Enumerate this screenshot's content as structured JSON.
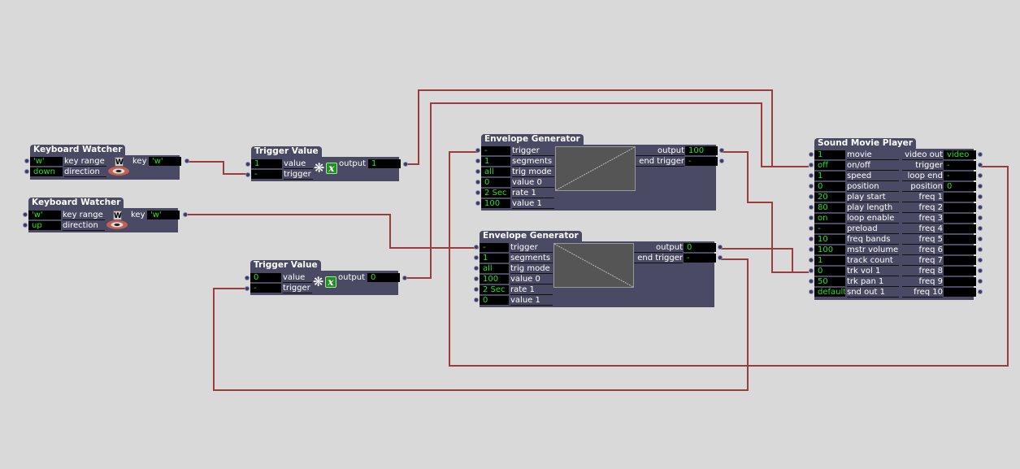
{
  "colors": {
    "background": "#d9d9d9",
    "actor_body": "#4a4a64",
    "value_text": "#22e622",
    "wire": "#993d3d"
  },
  "keyboard_watcher_1": {
    "title": "Keyboard Watcher",
    "inputs": [
      {
        "value": "'w'",
        "label": "key range"
      },
      {
        "value": "down",
        "label": "direction"
      }
    ],
    "output": {
      "label": "key",
      "value": "'w'"
    },
    "icon_letter": "W"
  },
  "keyboard_watcher_2": {
    "title": "Keyboard Watcher",
    "inputs": [
      {
        "value": "'w'",
        "label": "key range"
      },
      {
        "value": "up",
        "label": "direction"
      }
    ],
    "output": {
      "label": "key",
      "value": "'w'"
    },
    "icon_letter": "W"
  },
  "trigger_value_1": {
    "title": "Trigger Value",
    "inputs": [
      {
        "value": "1",
        "label": "value"
      },
      {
        "value": "-",
        "label": "trigger"
      }
    ],
    "output": {
      "label": "output",
      "value": "1"
    },
    "icon_letter": "x"
  },
  "trigger_value_2": {
    "title": "Trigger Value",
    "inputs": [
      {
        "value": "0",
        "label": "value"
      },
      {
        "value": "-",
        "label": "trigger"
      }
    ],
    "output": {
      "label": "output",
      "value": "0"
    },
    "icon_letter": "x"
  },
  "envelope_generator_1": {
    "title": "Envelope Generator",
    "inputs": [
      {
        "value": "-",
        "label": "trigger"
      },
      {
        "value": "1",
        "label": "segments"
      },
      {
        "value": "all",
        "label": "trig mode"
      },
      {
        "value": "0",
        "label": "value 0"
      },
      {
        "value": "2 Sec",
        "label": "rate 1"
      },
      {
        "value": "100",
        "label": "value 1"
      }
    ],
    "outputs": [
      {
        "label": "output",
        "value": "100"
      },
      {
        "label": "end trigger",
        "value": "-"
      }
    ],
    "curve": {
      "start": 0,
      "end": 100
    }
  },
  "envelope_generator_2": {
    "title": "Envelope Generator",
    "inputs": [
      {
        "value": "-",
        "label": "trigger"
      },
      {
        "value": "1",
        "label": "segments"
      },
      {
        "value": "all",
        "label": "trig mode"
      },
      {
        "value": "100",
        "label": "value 0"
      },
      {
        "value": "2 Sec",
        "label": "rate 1"
      },
      {
        "value": "0",
        "label": "value 1"
      }
    ],
    "outputs": [
      {
        "label": "output",
        "value": "0"
      },
      {
        "label": "end trigger",
        "value": "-"
      }
    ],
    "curve": {
      "start": 100,
      "end": 0
    }
  },
  "sound_movie_player": {
    "title": "Sound Movie Player",
    "inputs": [
      {
        "value": "1",
        "label": "movie"
      },
      {
        "value": "off",
        "label": "on/off"
      },
      {
        "value": "1",
        "label": "speed"
      },
      {
        "value": "0",
        "label": "position"
      },
      {
        "value": "20",
        "label": "play start"
      },
      {
        "value": "80",
        "label": "play length"
      },
      {
        "value": "on",
        "label": "loop enable"
      },
      {
        "value": "-",
        "label": "preload"
      },
      {
        "value": "10",
        "label": "freq bands"
      },
      {
        "value": "100",
        "label": "mstr volume"
      },
      {
        "value": "1",
        "label": "track count"
      },
      {
        "value": "0",
        "label": "trk vol 1"
      },
      {
        "value": "50",
        "label": "trk pan 1"
      },
      {
        "value": "default",
        "label": "snd out 1"
      }
    ],
    "outputs": [
      {
        "label": "video out",
        "value": "video"
      },
      {
        "label": "trigger",
        "value": "-"
      },
      {
        "label": "loop end",
        "value": "-"
      },
      {
        "label": "position",
        "value": "0"
      },
      {
        "label": "freq 1",
        "value": ""
      },
      {
        "label": "freq 2",
        "value": ""
      },
      {
        "label": "freq 3",
        "value": ""
      },
      {
        "label": "freq 4",
        "value": ""
      },
      {
        "label": "freq 5",
        "value": ""
      },
      {
        "label": "freq 6",
        "value": ""
      },
      {
        "label": "freq 7",
        "value": ""
      },
      {
        "label": "freq 8",
        "value": ""
      },
      {
        "label": "freq 9",
        "value": ""
      },
      {
        "label": "freq 10",
        "value": ""
      }
    ]
  }
}
